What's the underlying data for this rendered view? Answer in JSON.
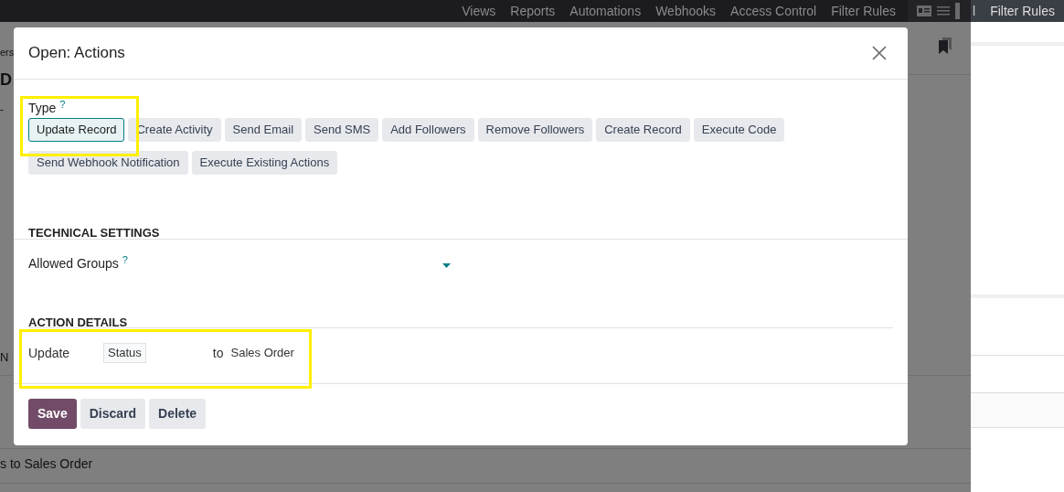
{
  "top_nav": {
    "items": [
      "Views",
      "Reports",
      "Automations",
      "Webhooks",
      "Access Control",
      "Filter Rules"
    ]
  },
  "right_panel": {
    "tab_fragment": "l",
    "tab": "Filter Rules"
  },
  "background": {
    "fragments": [
      "ers",
      "D",
      "-",
      "N",
      "s to Sales Order"
    ]
  },
  "dialog": {
    "title": "Open: Actions",
    "type": {
      "label": "Type",
      "help": "?",
      "options": [
        {
          "label": "Update Record",
          "selected": true
        },
        {
          "label": "Create Activity",
          "selected": false
        },
        {
          "label": "Send Email",
          "selected": false
        },
        {
          "label": "Send SMS",
          "selected": false
        },
        {
          "label": "Add Followers",
          "selected": false
        },
        {
          "label": "Remove Followers",
          "selected": false
        },
        {
          "label": "Create Record",
          "selected": false
        },
        {
          "label": "Execute Code",
          "selected": false
        },
        {
          "label": "Send Webhook Notification",
          "selected": false
        },
        {
          "label": "Execute Existing Actions",
          "selected": false
        }
      ]
    },
    "technical_settings": {
      "heading": "TECHNICAL SETTINGS",
      "allowed_groups": {
        "label": "Allowed Groups",
        "help": "?"
      }
    },
    "action_details": {
      "heading": "ACTION DETAILS",
      "update_label": "Update",
      "field": "Status",
      "to_label": "to",
      "value": "Sales Order"
    },
    "buttons": [
      {
        "label": "Save",
        "kind": "primary"
      },
      {
        "label": "Discard",
        "kind": "secondary"
      },
      {
        "label": "Delete",
        "kind": "secondary"
      }
    ]
  }
}
